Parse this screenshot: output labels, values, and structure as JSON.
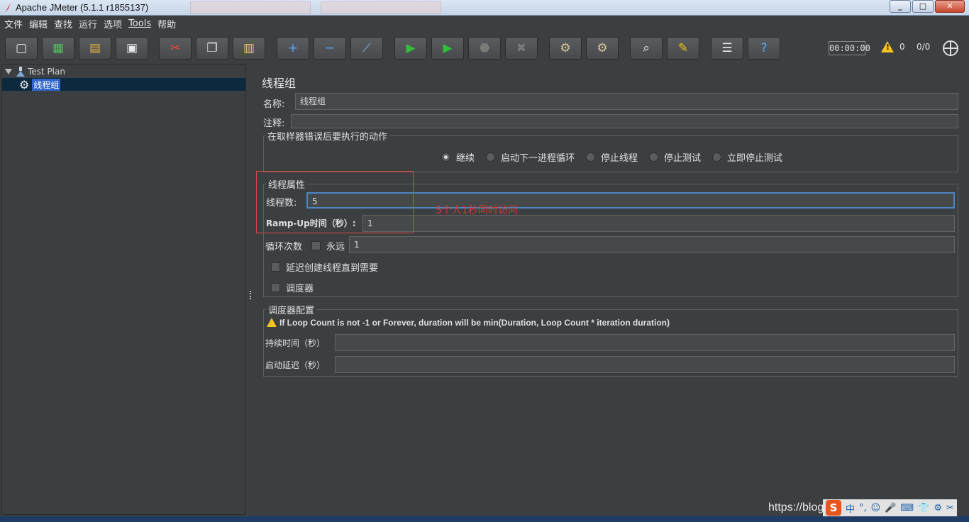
{
  "window": {
    "title": "Apache JMeter (5.1.1 r1855137)",
    "controls": [
      "_",
      "□",
      "✕"
    ]
  },
  "menubar": [
    "文件",
    "编辑",
    "查找",
    "运行",
    "选项",
    "Tools",
    "帮助"
  ],
  "toolbar": {
    "buttons": [
      {
        "name": "new-icon",
        "glyph": "▢",
        "color": "#f5f5f5"
      },
      {
        "name": "templates-icon",
        "glyph": "▦",
        "color": "#4fbf5a"
      },
      {
        "name": "open-icon",
        "glyph": "▤",
        "color": "#e3b341"
      },
      {
        "name": "save-icon",
        "glyph": "▣",
        "color": "#e8e8e8"
      },
      {
        "name": "cut-icon",
        "glyph": "✂",
        "color": "#e74c3c"
      },
      {
        "name": "copy-icon",
        "glyph": "❐",
        "color": "#e8e8e8"
      },
      {
        "name": "paste-icon",
        "glyph": "▥",
        "color": "#e8c063"
      },
      {
        "name": "expand-icon",
        "glyph": "+",
        "color": "#5aa7ff"
      },
      {
        "name": "collapse-icon",
        "glyph": "−",
        "color": "#5aa7ff"
      },
      {
        "name": "toggle-icon",
        "glyph": "⟋",
        "color": "#8fb4e0"
      },
      {
        "name": "start-icon",
        "glyph": "▶",
        "color": "#2fbf3b"
      },
      {
        "name": "start-no-pause-icon",
        "glyph": "▶",
        "color": "#2fbf3b"
      },
      {
        "name": "stop-icon",
        "glyph": "⬣",
        "color": "#7a7a7a"
      },
      {
        "name": "shutdown-icon",
        "glyph": "✖",
        "color": "#7a7a7a"
      },
      {
        "name": "clear-icon",
        "glyph": "⚙",
        "color": "#d6c39a"
      },
      {
        "name": "clear-all-icon",
        "glyph": "⚙",
        "color": "#d6c39a"
      },
      {
        "name": "search-icon",
        "glyph": "⌕",
        "color": "#e8e8e8"
      },
      {
        "name": "reset-search-icon",
        "glyph": "✎",
        "color": "#f1c40f"
      },
      {
        "name": "function-helper-icon",
        "glyph": "☰",
        "color": "#e8e8e8"
      },
      {
        "name": "help-icon",
        "glyph": "?",
        "color": "#5aa7ff"
      }
    ],
    "timer": "00:00:00",
    "warning_count": "0",
    "threads_ratio": "0/0"
  },
  "tree": {
    "root_label": "Test Plan",
    "selected_label": "线程组"
  },
  "panel": {
    "title": "线程组",
    "name_label": "名称:",
    "name_value": "线程组",
    "comment_label": "注释:",
    "comment_value": "",
    "error_action": {
      "title": "在取样器错误后要执行的动作",
      "options": [
        "继续",
        "启动下一进程循环",
        "停止线程",
        "停止测试",
        "立即停止测试"
      ],
      "selected": "继续"
    },
    "thread_props": {
      "title": "线程属性",
      "threads_label": "线程数:",
      "threads_value": "5",
      "rampup_label": "Ramp-Up时间（秒）:",
      "rampup_value": "1",
      "loop_label": "循环次数",
      "forever_label": "永远",
      "loop_value": "1",
      "delay_label": "延迟创建线程直到需要",
      "scheduler_label": "调度器"
    },
    "scheduler_config": {
      "title": "调度器配置",
      "warning": "If Loop Count is not -1 or Forever, duration will be min(Duration, Loop Count * iteration duration)",
      "duration_label": "持续时间（秒）",
      "duration_value": "",
      "startup_delay_label": "启动延迟（秒）",
      "startup_delay_value": ""
    },
    "annotation_text": "5个人1秒同时访问"
  },
  "overlay": {
    "watermark": "https://blog",
    "tray_items": [
      "中",
      "°,",
      "☺",
      "🎤",
      "⌨",
      "👕",
      "⚙",
      "✂"
    ]
  }
}
